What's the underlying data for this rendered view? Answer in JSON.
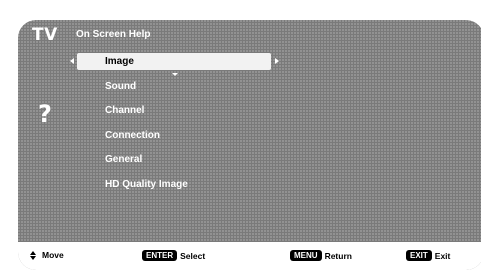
{
  "header": {
    "logo": "TV",
    "title": "On Screen Help"
  },
  "help_icon": "?",
  "menu": {
    "items": [
      {
        "label": "Image",
        "selected": true
      },
      {
        "label": "Sound",
        "selected": false
      },
      {
        "label": "Channel",
        "selected": false
      },
      {
        "label": "Connection",
        "selected": false
      },
      {
        "label": "General",
        "selected": false
      },
      {
        "label": "HD Quality Image",
        "selected": false
      }
    ]
  },
  "footer": {
    "move_label": "Move",
    "enter_key": "ENTER",
    "select_label": "Select",
    "menu_key": "MENU",
    "return_label": "Return",
    "exit_key": "EXIT",
    "exit_label": "Exit"
  },
  "colors": {
    "background": "#7a7a7a",
    "text": "#ffffff",
    "highlight": "#f2f2f2",
    "key_background": "#000000"
  },
  "icons": {
    "nav_left": "triangle-left",
    "nav_right": "triangle-right",
    "nav_down": "triangle-down",
    "move": "up-down-arrows"
  }
}
